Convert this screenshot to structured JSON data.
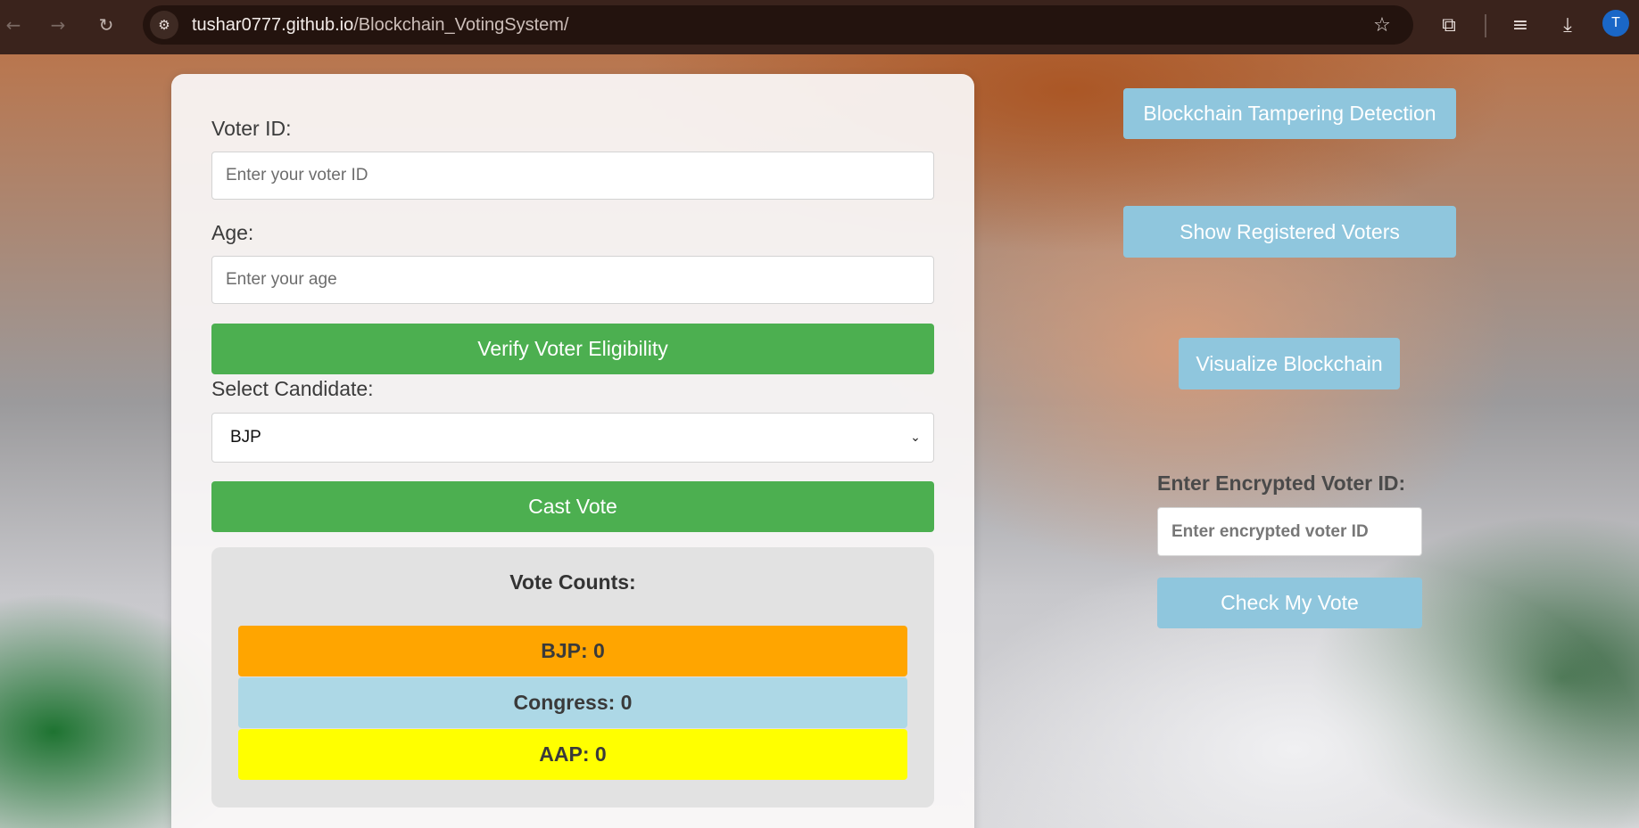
{
  "browser": {
    "url_host": "tushar0777.github.io",
    "url_path": "/Blockchain_VotingSystem/",
    "profile_initial": "T",
    "icons": {
      "back": "arrow-left-icon",
      "forward": "arrow-right-icon",
      "reload": "reload-icon",
      "site_info": "tune-icon",
      "bookmark": "star-icon",
      "extensions": "puzzle-icon",
      "media": "playlist-icon",
      "downloads": "download-icon"
    }
  },
  "form": {
    "voter_id_label": "Voter ID:",
    "voter_id_placeholder": "Enter your voter ID",
    "age_label": "Age:",
    "age_placeholder": "Enter your age",
    "verify_button": "Verify Voter Eligibility",
    "candidate_label": "Select Candidate:",
    "candidate_selected": "BJP",
    "cast_button": "Cast Vote"
  },
  "vote_counts": {
    "title": "Vote Counts:",
    "rows": [
      {
        "label": "BJP: 0",
        "color": "#ffa500"
      },
      {
        "label": "Congress: 0",
        "color": "#add8e6"
      },
      {
        "label": "AAP: 0",
        "color": "#ffff00"
      }
    ]
  },
  "side": {
    "tamper_button": "Blockchain Tampering Detection",
    "show_voters_button": "Show Registered Voters",
    "visualize_button": "Visualize Blockchain",
    "encrypted_label": "Enter Encrypted Voter ID:",
    "encrypted_placeholder": "Enter encrypted voter ID",
    "check_button": "Check My Vote"
  },
  "colors": {
    "green": "#4caf50",
    "light_blue": "#8fc6dd"
  }
}
